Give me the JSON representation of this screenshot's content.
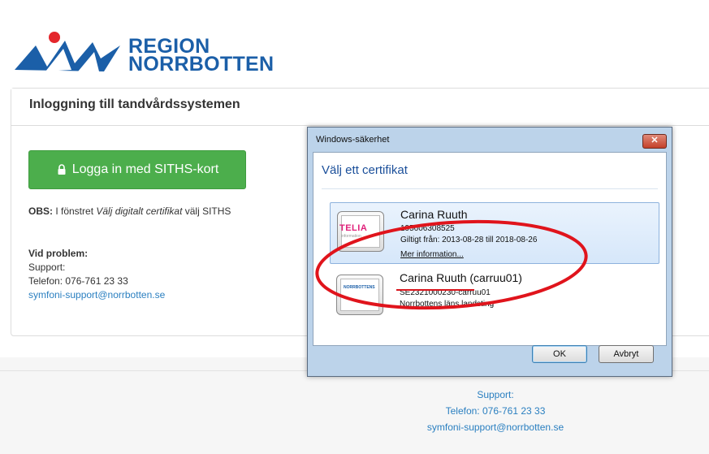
{
  "brand": {
    "logo_line1": "REGION",
    "logo_line2": "NORRBOTTEN",
    "color": "#1b5fa8",
    "accent": "#e4262c"
  },
  "panel": {
    "title": "Inloggning till tandvårdssystemen",
    "login_button": "Logga in med SITHS-kort",
    "login_icon": "lock-icon",
    "obs_label": "OBS:",
    "obs_text_1": " I fönstret ",
    "obs_text_em": "Välj digitalt certifikat",
    "obs_text_2": " välj SITHS",
    "problem_heading": "Vid problem:",
    "support_label": "Support:",
    "phone": "Telefon: 076-761 23 33",
    "email": "symfoni-support@norrbotten.se"
  },
  "footer": {
    "support_label": "Support:",
    "phone": "Telefon: 076-761 23 33",
    "email": "symfoni-support@norrbotten.se"
  },
  "dialog": {
    "window_title": "Windows-säkerhet",
    "close_glyph": "✕",
    "heading": "Välj ett certifikat",
    "certificates": [
      {
        "name": "Carina Ruuth",
        "line1": "195606308525",
        "line2": "Giltigt från: 2013-08-28 till 2018-08-26",
        "more": "Mer information...",
        "issuer_logo": "TELIA",
        "issuer_logo_sub": "information"
      },
      {
        "name": "Carina Ruuth (carruu01)",
        "line1": "SE2321000230-carruu01",
        "line2": "Norrbottens läns landsting",
        "issuer_logo": "NORRBOTTENS"
      }
    ],
    "ok_label": "OK",
    "cancel_label": "Avbryt"
  }
}
